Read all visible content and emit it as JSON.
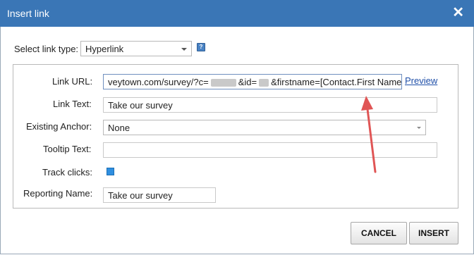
{
  "dialog": {
    "title": "Insert link",
    "close_icon": "close-icon"
  },
  "link_type": {
    "label": "Select link type:",
    "value": "Hyperlink",
    "help_icon": "help-icon"
  },
  "form": {
    "link_url": {
      "label": "Link URL:",
      "value_part1": "veytown.com/survey/?c=",
      "value_part2": "&id=",
      "value_part3": "&firstname=[Contact.First Name]"
    },
    "preview_label": "Preview",
    "link_text": {
      "label": "Link Text:",
      "value": "Take our survey"
    },
    "existing_anchor": {
      "label": "Existing Anchor:",
      "value": "None"
    },
    "tooltip_text": {
      "label": "Tooltip Text:",
      "value": ""
    },
    "track_clicks": {
      "label": "Track clicks:",
      "checked": true
    },
    "reporting_name": {
      "label": "Reporting Name:",
      "value": "Take our survey"
    }
  },
  "buttons": {
    "cancel": "CANCEL",
    "insert": "INSERT"
  },
  "colors": {
    "titlebar": "#3a76b6",
    "arrow": "#e05555",
    "checkbox": "#2f8fe0"
  }
}
